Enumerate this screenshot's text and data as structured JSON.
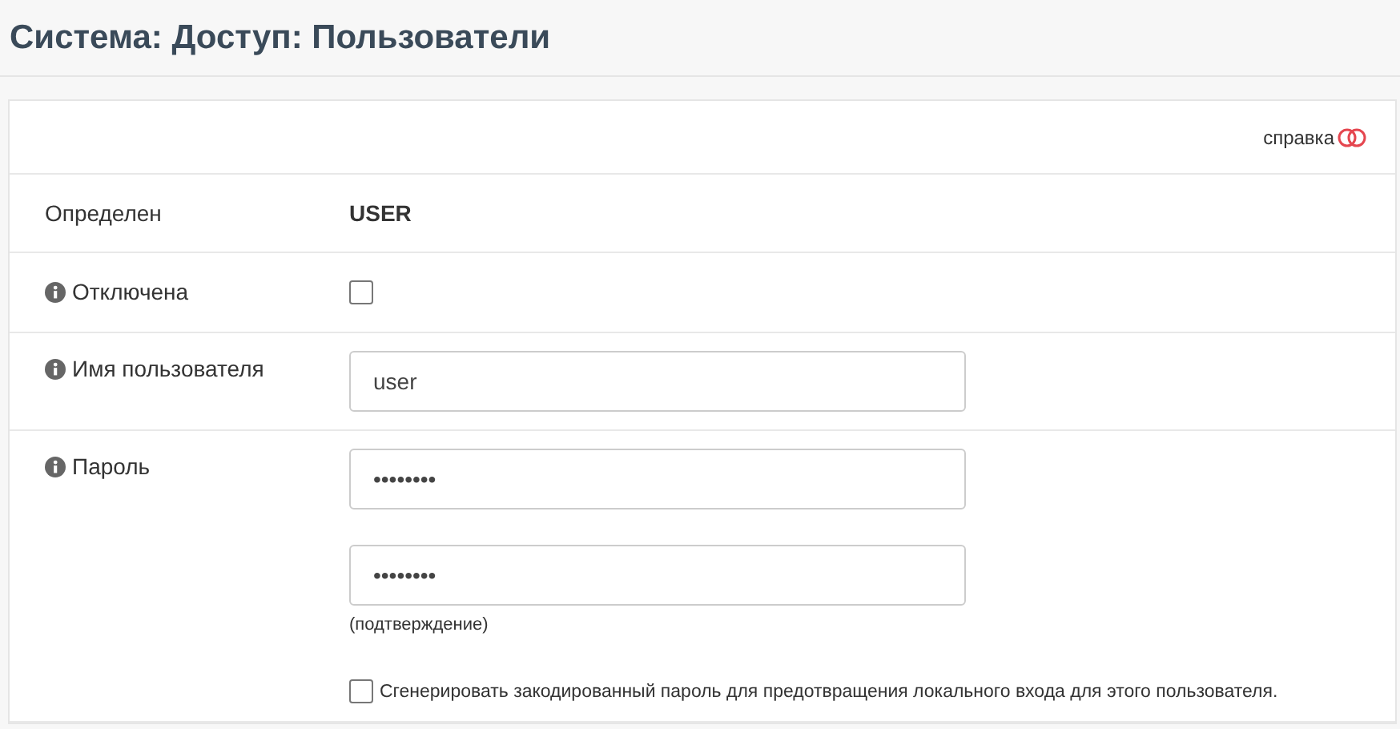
{
  "page_title": "Система: Доступ: Пользователи",
  "help": {
    "label": "справка",
    "on": false
  },
  "rows": [
    {
      "kind": "text",
      "label": "Определен",
      "info": false,
      "value": "USER"
    },
    {
      "kind": "checkbox",
      "label": "Отключена",
      "info": true,
      "checked": false
    },
    {
      "kind": "input",
      "label": "Имя пользователя",
      "info": true,
      "value": "user"
    },
    {
      "kind": "password",
      "label": "Пароль",
      "info": true,
      "value": "••••••••",
      "confirm_value": "••••••••",
      "confirm_hint": "(подтверждение)",
      "generate_label": "Сгенерировать закодированный пароль для предотвращения локального входа для этого пользователя.",
      "generate_checked": false
    }
  ]
}
